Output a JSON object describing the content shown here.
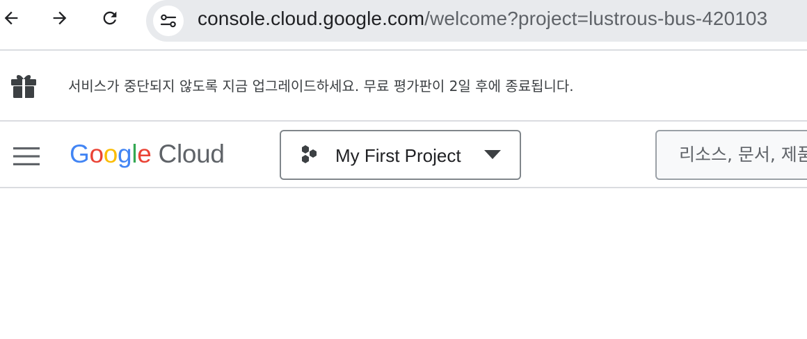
{
  "browser": {
    "url_host": "console.cloud.google.com",
    "url_path": "/welcome?project=lustrous-bus-420103",
    "icons": [
      "back-arrow-icon",
      "forward-arrow-icon",
      "reload-icon",
      "site-settings-icon"
    ]
  },
  "banner": {
    "icon": "gift-icon",
    "text": "서비스가 중단되지 않도록 지금 업그레이드하세요. 무료 평가판이 2일 후에 종료됩니다."
  },
  "header": {
    "logo": {
      "g1": "G",
      "o1": "o",
      "o2": "o",
      "g2": "g",
      "l": "l",
      "e": "e",
      "cloud": "Cloud"
    },
    "project_picker": {
      "label": "My First Project",
      "icon": "project-hexagons-icon"
    },
    "search": {
      "placeholder": "리소스, 문서, 제품 등 검색"
    }
  },
  "colors": {
    "google_blue": "#4285f4",
    "google_red": "#ea4335",
    "google_yellow": "#fbbc04",
    "google_green": "#34a853",
    "divider": "#dadce0"
  }
}
